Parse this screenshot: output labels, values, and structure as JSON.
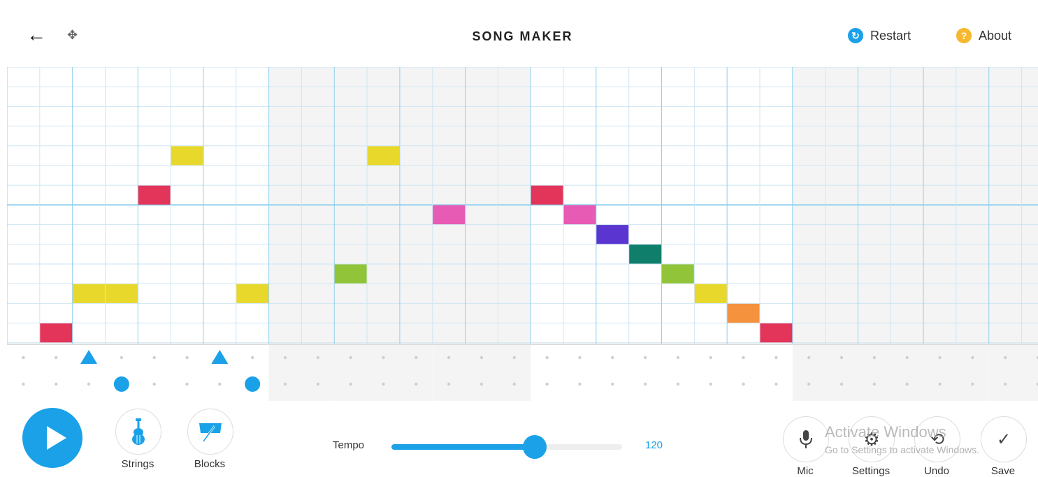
{
  "header": {
    "title": "SONG MAKER",
    "restart_label": "Restart",
    "about_label": "About"
  },
  "grid": {
    "columns": 32,
    "melody_rows": 14,
    "notes": [
      {
        "col": 1,
        "row": 13,
        "color": "#e3345a"
      },
      {
        "col": 2,
        "row": 11,
        "color": "#e8d82b"
      },
      {
        "col": 3,
        "row": 11,
        "color": "#e8d82b"
      },
      {
        "col": 4,
        "row": 6,
        "color": "#e3345a"
      },
      {
        "col": 5,
        "row": 4,
        "color": "#e8d82b"
      },
      {
        "col": 7,
        "row": 11,
        "color": "#e8d82b"
      },
      {
        "col": 10,
        "row": 10,
        "color": "#92c43a"
      },
      {
        "col": 11,
        "row": 4,
        "color": "#e8d82b"
      },
      {
        "col": 13,
        "row": 7,
        "color": "#e85bb4"
      },
      {
        "col": 16,
        "row": 6,
        "color": "#e3345a"
      },
      {
        "col": 17,
        "row": 7,
        "color": "#e85bb4"
      },
      {
        "col": 18,
        "row": 8,
        "color": "#5b35d0"
      },
      {
        "col": 19,
        "row": 9,
        "color": "#0f7f6c"
      },
      {
        "col": 20,
        "row": 10,
        "color": "#92c43a"
      },
      {
        "col": 21,
        "row": 11,
        "color": "#e8d82b"
      },
      {
        "col": 22,
        "row": 12,
        "color": "#f5923e"
      },
      {
        "col": 23,
        "row": 13,
        "color": "#e3345a"
      }
    ],
    "percussion": [
      {
        "col": 2,
        "row": 0,
        "shape": "triangle"
      },
      {
        "col": 6,
        "row": 0,
        "shape": "triangle"
      },
      {
        "col": 3,
        "row": 1,
        "shape": "circle"
      },
      {
        "col": 7,
        "row": 1,
        "shape": "circle"
      }
    ]
  },
  "colors": {
    "accent": "#1aa1e8",
    "line": "#cfe6f3",
    "barline": "#8fd0ee",
    "shade": "#f4f4f4"
  },
  "controls": {
    "instrument_label": "Strings",
    "instrument_icon": "violin-icon",
    "percussion_label": "Blocks",
    "percussion_icon": "woodblock-icon",
    "tempo_label": "Tempo",
    "tempo_value": "120",
    "tempo_fraction": 0.62,
    "mic_label": "Mic",
    "settings_label": "Settings",
    "undo_label": "Undo",
    "save_label": "Save"
  },
  "watermark": {
    "line1": "Activate Windows",
    "line2": "Go to Settings to activate Windows."
  }
}
